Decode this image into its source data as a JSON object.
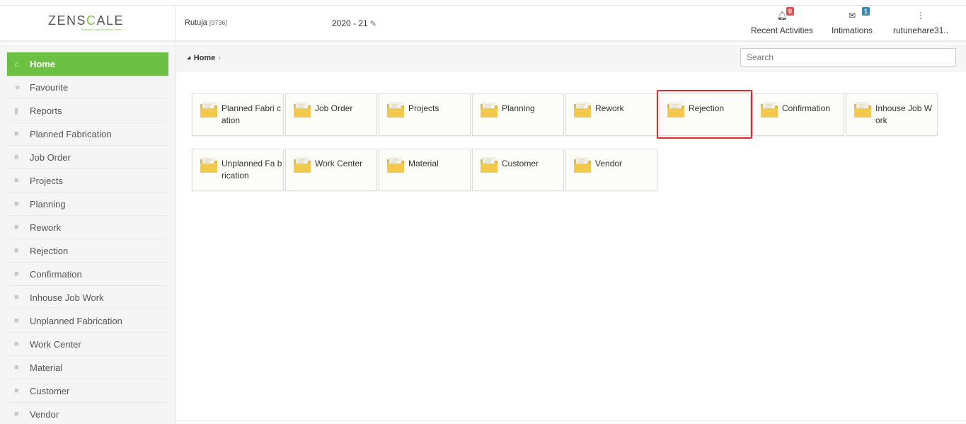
{
  "header": {
    "logo_prefix": "ZENS",
    "logo_accent": "C",
    "logo_suffix": "ALE",
    "logo_tagline": "Business Logic Business Focus",
    "user_name": "Rutuja",
    "user_code": "[9736]",
    "fiscal_year": "2020 - 21",
    "recent_activities_label": "Recent Activities",
    "recent_activities_count": "0",
    "intimations_label": "Intimations",
    "intimations_count": "1",
    "account_label": "rutunehare31.."
  },
  "sidebar": {
    "items": [
      {
        "label": "Home",
        "icon": "home-icon"
      },
      {
        "label": "Favourite",
        "icon": "star-icon"
      },
      {
        "label": "Reports",
        "icon": "file-icon"
      },
      {
        "label": "Planned Fabrication",
        "icon": "folder-icon"
      },
      {
        "label": "Job Order",
        "icon": "folder-icon"
      },
      {
        "label": "Projects",
        "icon": "folder-icon"
      },
      {
        "label": "Planning",
        "icon": "folder-icon"
      },
      {
        "label": "Rework",
        "icon": "folder-icon"
      },
      {
        "label": "Rejection",
        "icon": "folder-icon"
      },
      {
        "label": "Confirmation",
        "icon": "folder-icon"
      },
      {
        "label": "Inhouse Job Work",
        "icon": "folder-icon"
      },
      {
        "label": "Unplanned Fabrication",
        "icon": "folder-icon"
      },
      {
        "label": "Work Center",
        "icon": "folder-icon"
      },
      {
        "label": "Material",
        "icon": "folder-icon"
      },
      {
        "label": "Customer",
        "icon": "folder-icon"
      },
      {
        "label": "Vendor",
        "icon": "folder-icon"
      }
    ]
  },
  "breadcrumb": {
    "home": "Home"
  },
  "search": {
    "placeholder": "Search"
  },
  "tiles": [
    {
      "label": "Planned Fabri cation"
    },
    {
      "label": "Job Order"
    },
    {
      "label": "Projects"
    },
    {
      "label": "Planning"
    },
    {
      "label": "Rework"
    },
    {
      "label": "Rejection"
    },
    {
      "label": "Confirmation"
    },
    {
      "label": "Inhouse Job Work"
    },
    {
      "label": "Unplanned Fa brication"
    },
    {
      "label": "Work Center"
    },
    {
      "label": "Material"
    },
    {
      "label": "Customer"
    },
    {
      "label": "Vendor"
    }
  ],
  "colors": {
    "accent": "#6cc043",
    "highlight": "#e3262e",
    "folder": "#f2c94c"
  }
}
